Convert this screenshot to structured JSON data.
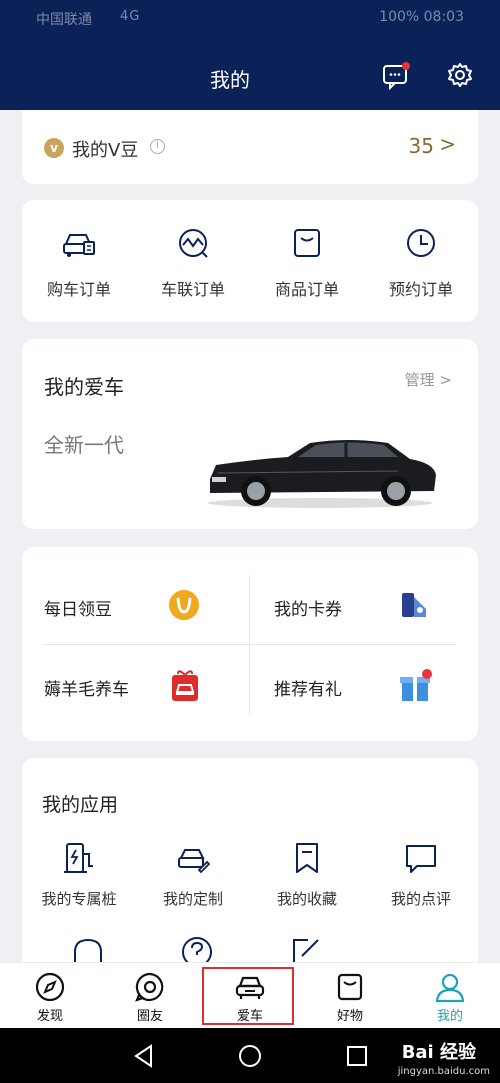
{
  "status_bar": {
    "carrier": "中国联通",
    "signal": "4G",
    "battery": "100%",
    "time": "08:03"
  },
  "header": {
    "title": "我的"
  },
  "vdou": {
    "label": "我的V豆",
    "count": "35",
    "arrow": ">",
    "badge": "v"
  },
  "orders": [
    {
      "label": "购车订单",
      "icon": "car-order-icon"
    },
    {
      "label": "车联订单",
      "icon": "connected-car-icon"
    },
    {
      "label": "商品订单",
      "icon": "shopping-bag-icon"
    },
    {
      "label": "预约订单",
      "icon": "clock-icon"
    }
  ],
  "my_car": {
    "title": "我的爱车",
    "manage": "管理 >",
    "model": "全新一代"
  },
  "perks": [
    {
      "label": "每日领豆",
      "icon": "v-coin-icon"
    },
    {
      "label": "我的卡券",
      "icon": "coupon-icon"
    },
    {
      "label": "薅羊毛养车",
      "icon": "gift-car-icon"
    },
    {
      "label": "推荐有礼",
      "icon": "gift-box-icon"
    }
  ],
  "apps": {
    "title": "我的应用",
    "items": [
      {
        "label": "我的专属桩",
        "icon": "charging-pile-icon"
      },
      {
        "label": "我的定制",
        "icon": "car-edit-icon"
      },
      {
        "label": "我的收藏",
        "icon": "bookmark-icon"
      },
      {
        "label": "我的点评",
        "icon": "comment-icon"
      }
    ]
  },
  "tabs": [
    {
      "label": "发现",
      "icon": "compass-icon"
    },
    {
      "label": "圈友",
      "icon": "chat-circle-icon"
    },
    {
      "label": "爱车",
      "icon": "car-icon"
    },
    {
      "label": "好物",
      "icon": "bag-icon"
    },
    {
      "label": "我的",
      "icon": "user-icon",
      "active": true
    }
  ],
  "watermark": {
    "brand": "Bai 经验",
    "url": "jingyan.baidu.com"
  },
  "colors": {
    "header_bg": "#0b2259",
    "accent": "#1aa3b8",
    "gold": "#8a6b2e",
    "highlight": "#d9322e"
  }
}
